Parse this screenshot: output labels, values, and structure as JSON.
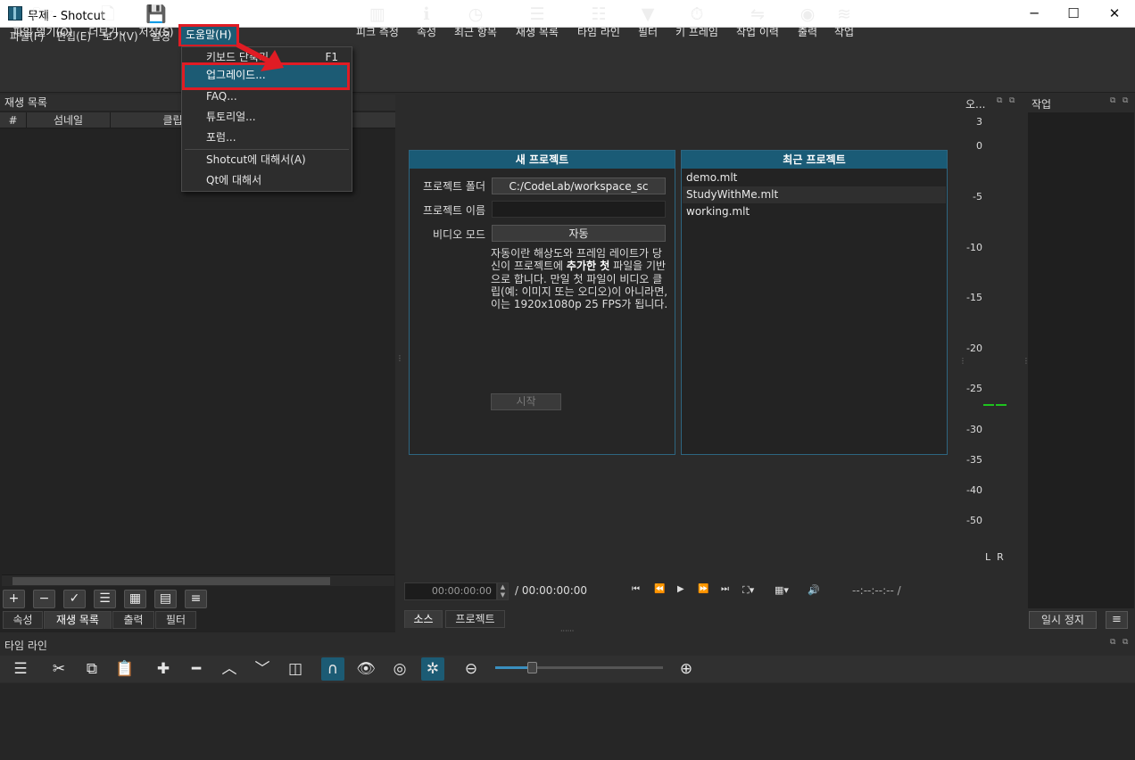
{
  "window": {
    "title": "무제 - Shotcut",
    "minimize": "─",
    "maximize": "☐",
    "close": "✕"
  },
  "menubar": [
    "파일(F)",
    "편집(E)",
    "보기(V)",
    "설정",
    "도움말(H)"
  ],
  "toolbar": [
    {
      "icon": "folder-open-icon",
      "glyph": "🗁",
      "label": "파일 열기(O)"
    },
    {
      "icon": "file-add-icon",
      "glyph": "🗋",
      "label": "더보기"
    },
    {
      "icon": "save-icon",
      "glyph": "💾",
      "label": "저장(S)"
    },
    {
      "icon": "peak-meter-icon",
      "glyph": "▥",
      "label": "피크 측정"
    },
    {
      "icon": "info-icon",
      "glyph": "i",
      "label": "속성"
    },
    {
      "icon": "clock-icon",
      "glyph": "◷",
      "label": "최근 항목"
    },
    {
      "icon": "list-icon",
      "glyph": "☰",
      "label": "재생 목록"
    },
    {
      "icon": "timeline-icon",
      "glyph": "☷",
      "label": "타임 라인"
    },
    {
      "icon": "filter-icon",
      "glyph": "▼",
      "label": "필터"
    },
    {
      "icon": "stopwatch-icon",
      "glyph": "⏱",
      "label": "키 프레임"
    },
    {
      "icon": "history-icon",
      "glyph": "⇋",
      "label": "작업 이력"
    },
    {
      "icon": "disc-icon",
      "glyph": "◉",
      "label": "출력"
    },
    {
      "icon": "database-icon",
      "glyph": "≋",
      "label": "작업"
    }
  ],
  "help_menu": {
    "items": [
      {
        "label": "키보드 단축키...",
        "shortcut": "F1"
      },
      {
        "label": "업그레이드..."
      },
      {
        "label": "FAQ..."
      },
      {
        "label": "튜토리얼..."
      },
      {
        "label": "포럼..."
      },
      {
        "label": "Shotcut에 대해서(A)"
      },
      {
        "label": "Qt에 대해서"
      }
    ]
  },
  "playlist": {
    "title": "재생 목록",
    "columns": [
      "#",
      "섬네일",
      "클립"
    ],
    "tools": [
      "+",
      "−",
      "✓",
      "☰",
      "▦",
      "▤",
      "≡"
    ],
    "tabs": [
      "속성",
      "재생 목록",
      "출력",
      "필터"
    ]
  },
  "new_project": {
    "title": "새 프로젝트",
    "folder_label": "프로젝트 폴더",
    "folder_value": "C:/CodeLab/workspace_sc",
    "name_label": "프로젝트 이름",
    "name_value": "",
    "video_mode_label": "비디오 모드",
    "video_mode_value": "자동",
    "desc_1": "자동이란 해상도와 프레임 레이트가 당신이 프로젝트에 ",
    "desc_bold": "추가한 첫",
    "desc_2": " 파일을 기반으로 합니다. 만일 첫 파일이 비디오 클립(예: 이미지 또는 오디오)이 아니라면, 이는 1920x1080p 25 FPS가 됩니다.",
    "start": "시작"
  },
  "recent_project": {
    "title": "최근 프로젝트",
    "items": [
      "demo.mlt",
      "StudyWithMe.mlt",
      "working.mlt"
    ]
  },
  "viewer": {
    "timecode": "00:00:00:00",
    "duration": "/ 00:00:00:00",
    "inout": "--:--:--:-- /",
    "tabs": [
      "소스",
      "프로젝트"
    ]
  },
  "audio_meter": {
    "title": "오...",
    "ticks": [
      "3",
      "0",
      "-5",
      "-10",
      "-15",
      "-20",
      "-25",
      "-30",
      "-35",
      "-40",
      "-50"
    ],
    "channels": "L  R"
  },
  "jobs": {
    "title": "작업",
    "pause": "일시 정지",
    "menu": "≡"
  },
  "timeline": {
    "title": "타임 라인"
  }
}
